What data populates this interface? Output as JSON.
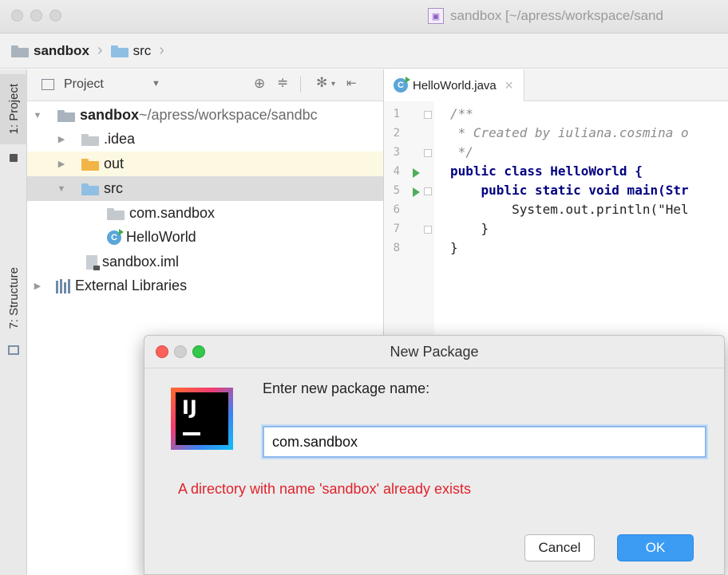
{
  "window": {
    "title": "sandbox [~/apress/workspace/sand"
  },
  "breadcrumb": {
    "items": [
      "sandbox",
      "src"
    ]
  },
  "toolstrip": {
    "tabs": [
      {
        "label": "1: Project",
        "icon": "folder-icon"
      },
      {
        "label": "7: Structure",
        "icon": "structure-icon"
      }
    ]
  },
  "project_panel": {
    "header": "Project",
    "tree": [
      {
        "name": "sandbox",
        "path": " ~/apress/workspace/sandbc",
        "level": 0,
        "expanded": true,
        "icon": "module-folder-icon"
      },
      {
        "name": ".idea",
        "level": 1,
        "expanded": false,
        "icon": "folder-icon"
      },
      {
        "name": "out",
        "level": 1,
        "expanded": false,
        "icon": "excluded-folder-icon"
      },
      {
        "name": "src",
        "level": 1,
        "expanded": true,
        "icon": "source-folder-icon",
        "selected": true
      },
      {
        "name": "com.sandbox",
        "level": 2,
        "icon": "package-icon"
      },
      {
        "name": "HelloWorld",
        "level": 2,
        "icon": "java-class-icon"
      },
      {
        "name": "sandbox.iml",
        "level": 1,
        "icon": "iml-file-icon"
      },
      {
        "name": "External Libraries",
        "level": 0,
        "expanded": false,
        "icon": "libraries-icon"
      }
    ]
  },
  "editor": {
    "tab": "HelloWorld.java",
    "line_numbers": [
      "1",
      "2",
      "3",
      "4",
      "5",
      "6",
      "7",
      "8"
    ],
    "lines": [
      "/**",
      " * Created by iuliana.cosmina o",
      " */",
      "public class HelloWorld {",
      "    public static void main(Str",
      "        System.out.println(\"Hel",
      "    }",
      "}"
    ]
  },
  "dialog": {
    "title": "New Package",
    "prompt": "Enter new package name:",
    "input_value": "com.sandbox",
    "error": "A directory with name 'sandbox' already exists",
    "cancel_label": "Cancel",
    "ok_label": "OK",
    "logo_text": "IJ"
  },
  "colors": {
    "error_red": "#e0222c",
    "ok_blue": "#3c9cf4",
    "selection_gray": "#dcdcdc",
    "highlight_yellow": "#fffae3"
  }
}
